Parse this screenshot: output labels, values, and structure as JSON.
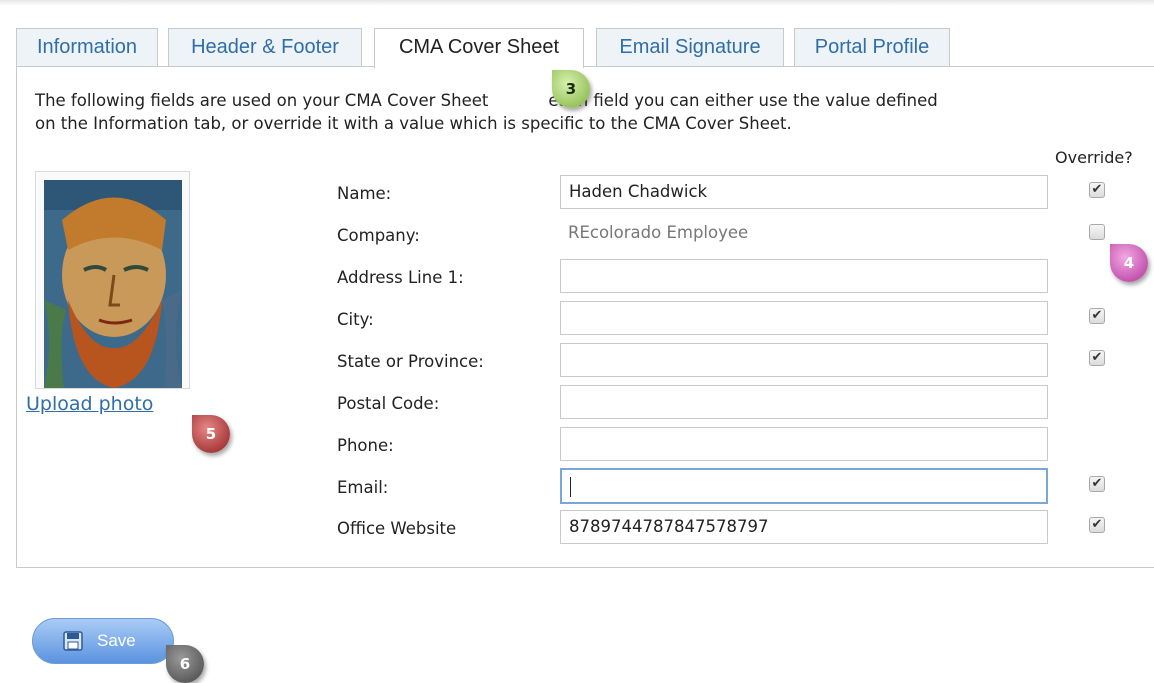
{
  "tabs": [
    {
      "label": "Information"
    },
    {
      "label": "Header & Footer"
    },
    {
      "label": "CMA Cover Sheet",
      "active": true
    },
    {
      "label": "Email Signature"
    },
    {
      "label": "Portal Profile"
    }
  ],
  "description_line1": "The following fields are used on your CMA Cover Sheet. For each field you can either use the value defined",
  "description_line1_shown": "The following fields are used on your CMA Cover Sheet",
  "description_line1_end": "each field you can either use the value defined",
  "description_line2": "on the Information tab, or override it with a value which is specific to the CMA Cover Sheet.",
  "override_header": "Override?",
  "photo": {
    "upload_label": "Upload photo"
  },
  "fields": [
    {
      "label": "Name:",
      "value": "Haden Chadwick",
      "override": true
    },
    {
      "label": "Company:",
      "value": "REcolorado Employee",
      "override": false,
      "readonly": true
    },
    {
      "label": "Address Line 1:",
      "value": "",
      "override": null
    },
    {
      "label": "City:",
      "value": "",
      "override": true
    },
    {
      "label": "State or Province:",
      "value": "",
      "override": true
    },
    {
      "label": "Postal Code:",
      "value": "",
      "override": null
    },
    {
      "label": "Phone:",
      "value": "",
      "override": null
    },
    {
      "label": "Email:",
      "value": "",
      "override": true,
      "focused": true
    },
    {
      "label": "Office Website",
      "value": "8789744787847578797",
      "override": true
    }
  ],
  "markers": {
    "m3": "3",
    "m4": "4",
    "m5": "5",
    "m6": "6"
  },
  "save_label": "Save",
  "colors": {
    "tab_link": "#2f6ea8",
    "save_button": "#5b93e0",
    "marker_3": "#7fb23a",
    "marker_4": "#b0339a",
    "marker_5": "#8f1d1d",
    "marker_6": "#444444"
  }
}
